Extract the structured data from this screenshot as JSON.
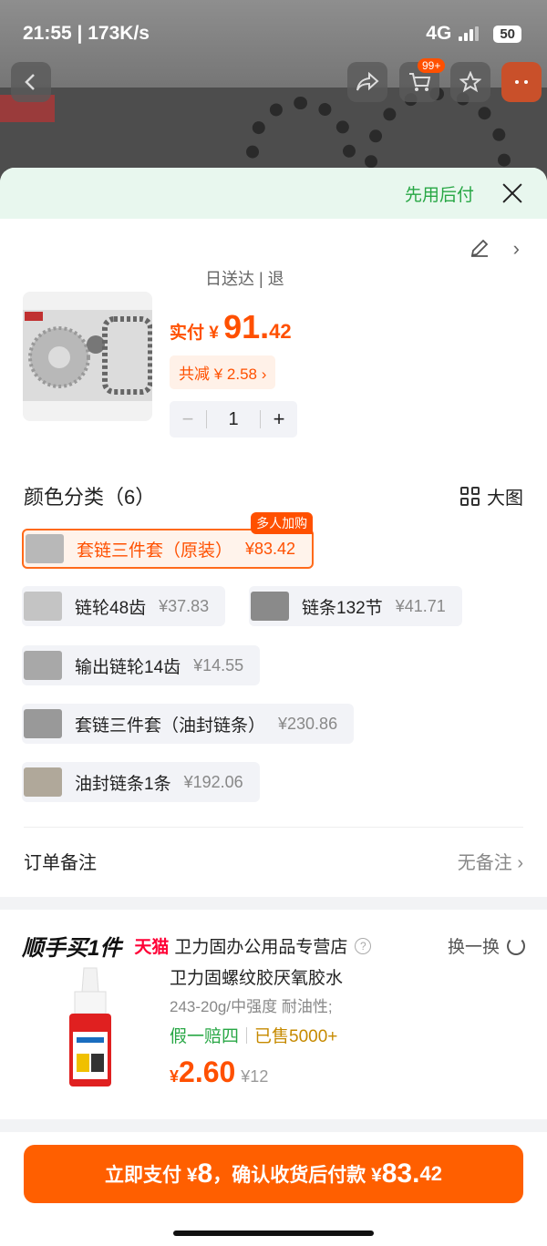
{
  "status": {
    "time_speed": "21:55 | 173K/s",
    "network": "4G",
    "battery": "50"
  },
  "topbar": {
    "cart_badge": "99+",
    "icons": [
      "back-icon",
      "share-icon",
      "cart-icon",
      "star-icon",
      "message-icon"
    ]
  },
  "banner": {
    "text": "先用后付"
  },
  "address": {
    "delivery_text": "日送达 | 退"
  },
  "product": {
    "price_label": "实付 ¥ ",
    "price_int": "91.",
    "price_dec": "42",
    "discount": "共减 ¥ 2.58 ›",
    "quantity": "1",
    "minus": "−",
    "plus": "+"
  },
  "variants_section": {
    "title": "颜色分类（6）",
    "big_view": "大图",
    "items": [
      {
        "name": "套链三件套（原装）",
        "price": "¥83.42",
        "tag": "多人加购"
      },
      {
        "name": "链轮48齿",
        "price": "¥37.83"
      },
      {
        "name": "链条132节",
        "price": "¥41.71"
      },
      {
        "name": "输出链轮14齿",
        "price": "¥14.55"
      },
      {
        "name": "套链三件套（油封链条）",
        "price": "¥230.86"
      },
      {
        "name": "油封链条1条",
        "price": "¥192.06"
      }
    ]
  },
  "remark": {
    "label": "订单备注",
    "value": "无备注 ›"
  },
  "addon": {
    "brand": "顺手买1件",
    "tmall": "天猫",
    "store": "卫力固办公用品专营店",
    "help": "?",
    "swap": "换一换",
    "title": "卫力固螺纹胶厌氧胶水",
    "subtitle": "243-20g/中强度 耐油性;",
    "guarantee": "假一赔四",
    "sold": "已售5000+",
    "currency": "¥",
    "price": "2.60",
    "old_price": "¥12"
  },
  "pay": {
    "part1": "立即支付 ¥",
    "part1_num": "8",
    "part2": "，确认收货后付款 ¥",
    "part2_num": "83.",
    "part2_dec": "42"
  },
  "colors": {
    "accent": "#ff5000",
    "green": "#28a745"
  }
}
